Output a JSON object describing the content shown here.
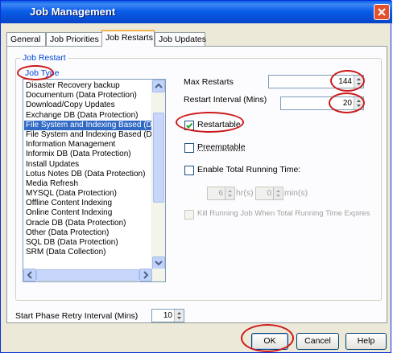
{
  "window": {
    "title": "Job Management"
  },
  "tabs": [
    {
      "label": "General"
    },
    {
      "label": "Job Priorities"
    },
    {
      "label": "Job Restarts"
    },
    {
      "label": "Job Updates"
    }
  ],
  "group": {
    "label": "Job Restart"
  },
  "job_type": {
    "label": "Job Type",
    "items": [
      "Disaster Recovery backup",
      "Documentum (Data Protection)",
      "Download/Copy Updates",
      "Exchange DB (Data Protection)",
      "File System and Indexing Based (D",
      "File System and Indexing Based (D",
      "Information Management",
      "Informix DB (Data Protection)",
      "Install Updates",
      "Lotus Notes DB (Data Protection)",
      "Media Refresh",
      "MYSQL (Data Protection)",
      "Offline Content Indexing",
      "Online Content Indexing",
      "Oracle DB (Data Protection)",
      "Other (Data Protection)",
      "SQL DB (Data Protection)",
      "SRM (Data Collection)"
    ],
    "selected_index": 4
  },
  "max_restarts": {
    "label": "Max Restarts",
    "value": "144"
  },
  "restart_interval": {
    "label": "Restart Interval (Mins)",
    "value": "20"
  },
  "restartable": {
    "label": "Restartable",
    "checked": true
  },
  "preemptable": {
    "label": "Preemptable",
    "checked": false
  },
  "total_running": {
    "label": "Enable Total Running Time:",
    "hours_value": "6",
    "hours_label": "hr(s)",
    "mins_value": "0",
    "mins_label": "min(s)",
    "kill_label": "Kill Running Job When Total Running Time Expires"
  },
  "start_phase": {
    "label": "Start Phase Retry Interval (Mins)",
    "value": "10"
  },
  "buttons": {
    "ok": "OK",
    "cancel": "Cancel",
    "help": "Help"
  },
  "colors": {
    "titlebar": "#0a5ee8",
    "annotation": "#cc1a1a",
    "selection": "#316ac5"
  }
}
